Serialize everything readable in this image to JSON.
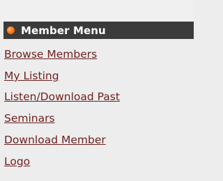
{
  "menu": {
    "title": "Member Menu",
    "items": [
      {
        "label": "Browse Members"
      },
      {
        "label": "My Listing"
      },
      {
        "label": "Listen/Download Past"
      },
      {
        "label": "Seminars"
      },
      {
        "label": "Download Member"
      },
      {
        "label": "Logo"
      }
    ]
  },
  "colors": {
    "header_bg": "#3b3b3b",
    "bullet": "#ff7a16",
    "link": "#6f1f1f",
    "page_bg": "#ededed"
  }
}
